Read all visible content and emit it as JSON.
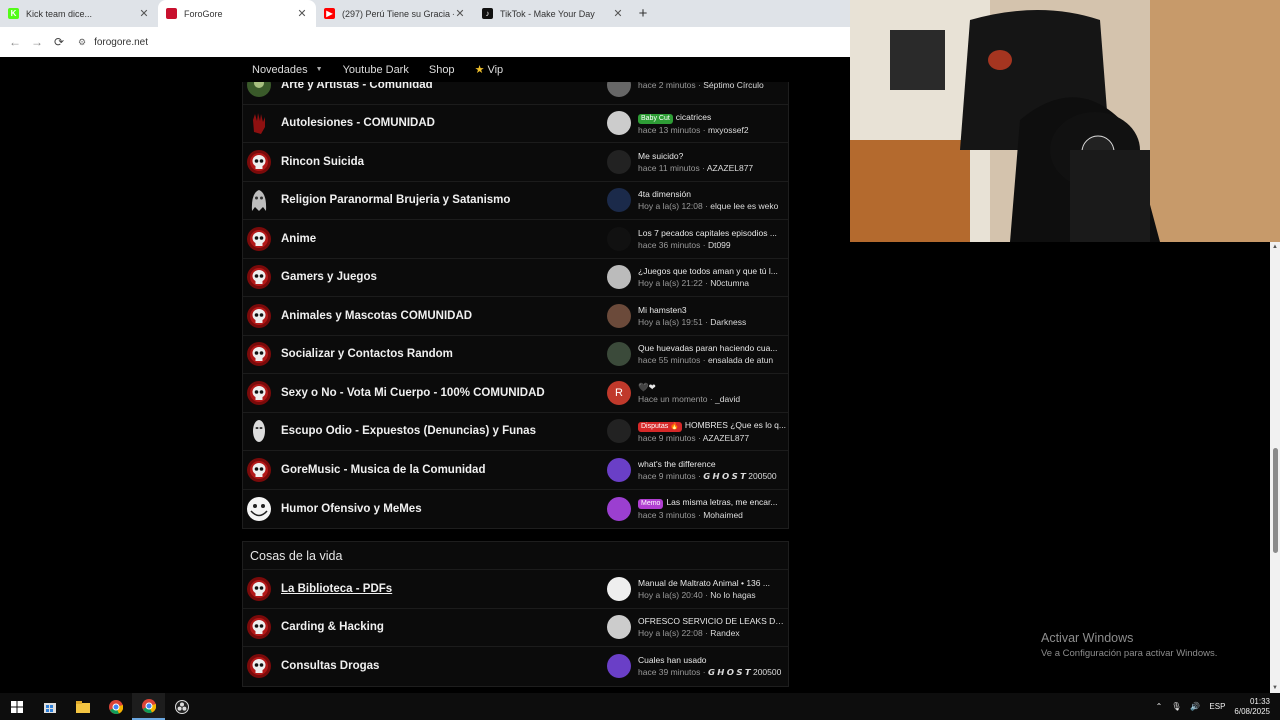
{
  "browser": {
    "tabs": [
      {
        "title": "Kick team dice...",
        "favicon_color": "#53fc18",
        "favicon_text": "K"
      },
      {
        "title": "ForoGore",
        "favicon_color": "#c8102e",
        "favicon_text": ""
      },
      {
        "title": "(297) Perú Tiene su Gracia - Lui",
        "favicon_color": "#ff0000",
        "favicon_text": "▶"
      },
      {
        "title": "TikTok - Make Your Day",
        "favicon_color": "#111111",
        "favicon_text": "♪"
      }
    ],
    "new_tab": "+",
    "url": "forogore.net"
  },
  "site_nav": {
    "items": [
      "Novedades",
      "Youtube Dark",
      "Shop",
      "Vip"
    ]
  },
  "forums": [
    {
      "name": "Arte y Artistas - Comunidad",
      "icon": "green-avatar-icon",
      "last_title": "",
      "last_time": "hace 2 minutos",
      "last_user": "Séptimo Círculo",
      "avatar_color": "#666666",
      "avatar_text": ""
    },
    {
      "name": "Autolesiones - COMUNIDAD",
      "icon": "bloody-hand-icon",
      "badge": "Baby Cut",
      "badge_color": "#2e9d36",
      "last_title": "cicatrices",
      "last_time": "hace 13 minutos",
      "last_user": "mxyossef2",
      "avatar_color": "#cccccc",
      "avatar_text": ""
    },
    {
      "name": "Rincon Suicida",
      "icon": "skull-icon",
      "last_title": "Me suicido?",
      "last_time": "hace 11 minutos",
      "last_user": "AZAZEL877",
      "avatar_color": "#222222",
      "avatar_text": ""
    },
    {
      "name": "Religion Paranormal Brujeria y Satanismo",
      "icon": "ghost-icon",
      "last_title": "4ta dimensión",
      "last_time": "Hoy a la(s) 12:08",
      "last_user": "elque lee es weko",
      "avatar_color": "#1b2a4a",
      "avatar_text": ""
    },
    {
      "name": "Anime",
      "icon": "skull-icon",
      "last_title": "Los 7 pecados capitales episodios ...",
      "last_time": "hace 36 minutos",
      "last_user": "Dt099",
      "avatar_color": "#111111",
      "avatar_text": ""
    },
    {
      "name": "Gamers y Juegos",
      "icon": "skull-icon",
      "last_title": "¿Juegos que todos aman y que tú l...",
      "last_time": "Hoy a la(s) 21:22",
      "last_user": "N0ctumna",
      "avatar_color": "#bbbbbb",
      "avatar_text": ""
    },
    {
      "name": "Animales y Mascotas COMUNIDAD",
      "icon": "skull-icon",
      "last_title": "Mi hamsten3",
      "last_time": "Hoy a la(s) 19:51",
      "last_user": "Darkness",
      "avatar_color": "#6b4a3a",
      "avatar_text": ""
    },
    {
      "name": "Socializar y Contactos Random",
      "icon": "skull-icon",
      "last_title": "Que huevadas paran haciendo cua...",
      "last_time": "hace 55 minutos",
      "last_user": "ensalada de atun",
      "avatar_color": "#3b4a3a",
      "avatar_text": ""
    },
    {
      "name": "Sexy o No - Vota Mi Cuerpo - 100% COMUNIDAD",
      "icon": "skull-icon",
      "last_title": "🖤❤",
      "last_time": "Hace un momento",
      "last_user": "_david",
      "avatar_color": "#c0392b",
      "avatar_text": "R"
    },
    {
      "name": "Escupo Odio - Expuestos (Denuncias) y Funas",
      "icon": "face-icon",
      "badge": "Disputas 🔥",
      "badge_color": "#d62828",
      "last_title": "HOMBRES ¿Que es lo q...",
      "last_time": "hace 9 minutos",
      "last_user": "AZAZEL877",
      "avatar_color": "#222222",
      "avatar_text": ""
    },
    {
      "name": "GoreMusic - Musica de la Comunidad",
      "icon": "skull-icon",
      "last_title": "what's the difference",
      "last_time": "hace 9 minutos",
      "last_user": "𝙂 𝙃 𝙊 𝙎 𝙏 200500",
      "avatar_color": "#6a3fc7",
      "avatar_text": ""
    },
    {
      "name": "Humor Ofensivo y MeMes",
      "icon": "trollface-icon",
      "badge": "Memo",
      "badge_color": "#b03fd0",
      "last_title": "Las misma letras, me encar...",
      "last_time": "hace 3 minutos",
      "last_user": "Mohaimed",
      "avatar_color": "#9b3fd0",
      "avatar_text": ""
    }
  ],
  "section2": {
    "title": "Cosas de la vida",
    "forums": [
      {
        "name": "La Biblioteca - PDFs",
        "icon": "skull-icon",
        "last_title": "Manual de Maltrato Animal • 136 ...",
        "last_time": "Hoy a la(s) 20:40",
        "last_user": "No lo hagas",
        "avatar_color": "#eeeeee",
        "avatar_text": ""
      },
      {
        "name": "Carding & Hacking",
        "icon": "skull-icon",
        "last_title": "OFRESCO SERVICIO DE LEAKS DE ...",
        "last_time": "Hoy a la(s) 22:08",
        "last_user": "Randex",
        "avatar_color": "#cccccc",
        "avatar_text": ""
      },
      {
        "name": "Consultas Drogas",
        "icon": "skull-icon",
        "last_title": "Cuales han usado",
        "last_time": "hace 39 minutos",
        "last_user": "𝙂 𝙃 𝙊 𝙎 𝙏 200500",
        "avatar_color": "#6a3fc7",
        "avatar_text": ""
      }
    ]
  },
  "windows_activation": {
    "title": "Activar Windows",
    "subtitle": "Ve a Configuración para activar Windows."
  },
  "taskbar": {
    "language": "ESP",
    "time": "01:33",
    "date": "6/08/2025"
  }
}
